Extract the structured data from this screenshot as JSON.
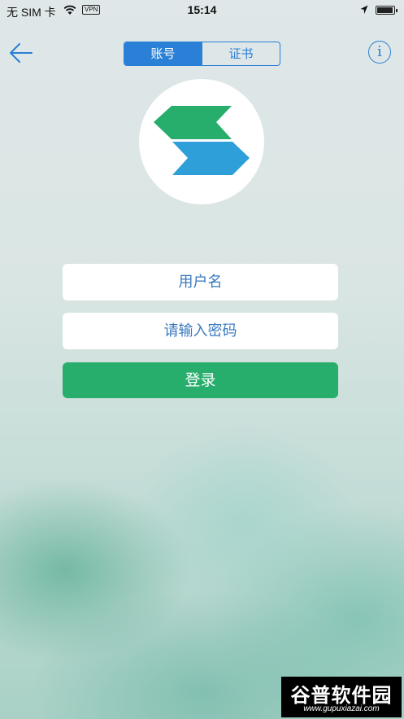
{
  "status_bar": {
    "carrier": "无 SIM 卡",
    "vpn": "VPN",
    "time": "15:14"
  },
  "nav": {
    "tabs": [
      {
        "label": "账号",
        "active": true
      },
      {
        "label": "证书",
        "active": false
      }
    ],
    "info_label": "i"
  },
  "logo": {
    "top_color": "#27ad6c",
    "bottom_color": "#2e9fd8"
  },
  "form": {
    "username_placeholder": "用户名",
    "password_placeholder": "请输入密码",
    "login_label": "登录"
  },
  "colors": {
    "accent": "#2a7fd6",
    "login_button": "#27ad6c"
  },
  "watermark": {
    "name": "谷普软件园",
    "url": "www.gupuxiazai.com"
  }
}
